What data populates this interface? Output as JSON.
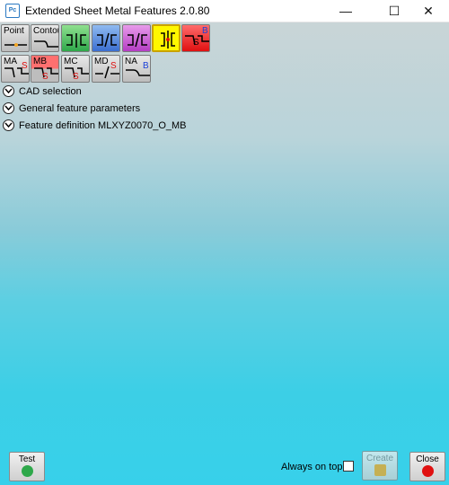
{
  "window": {
    "title": "Extended Sheet Metal Features 2.0.80",
    "app_icon_text": "Pc",
    "minimize_glyph": "—",
    "maximize_glyph": "☐",
    "close_glyph": "✕"
  },
  "toolbar": {
    "row1": [
      {
        "label": "Point",
        "style": "gray"
      },
      {
        "label": "Contour",
        "style": "gray"
      },
      {
        "label": "",
        "style": "green"
      },
      {
        "label": "",
        "style": "blue"
      },
      {
        "label": "",
        "style": "magenta"
      },
      {
        "label": "",
        "style": "yellow"
      },
      {
        "label": "",
        "style": "red",
        "letters": [
          "S",
          "B"
        ]
      }
    ],
    "row2": [
      {
        "label": "MA",
        "style": "gray",
        "letter": "S"
      },
      {
        "label": "MB",
        "style": "redgray",
        "letter": "S"
      },
      {
        "label": "MC",
        "style": "gray",
        "letter": "S"
      },
      {
        "label": "MD",
        "style": "gray",
        "letter": "S"
      },
      {
        "label": "NA",
        "style": "gray",
        "letter": "B"
      }
    ]
  },
  "sections": [
    {
      "label": "CAD selection"
    },
    {
      "label": "General feature parameters"
    },
    {
      "label": "Feature definition MLXYZ0070_O_MB"
    }
  ],
  "bottom": {
    "test_label": "Test",
    "always_on_top_label": "Always on top",
    "always_on_top_checked": false,
    "create_label": "Create",
    "close_label": "Close"
  },
  "colors": {
    "green": "#2ea84a",
    "red": "#e01010",
    "orange": "#f5a623",
    "accent_blue": "#2b79c2"
  }
}
